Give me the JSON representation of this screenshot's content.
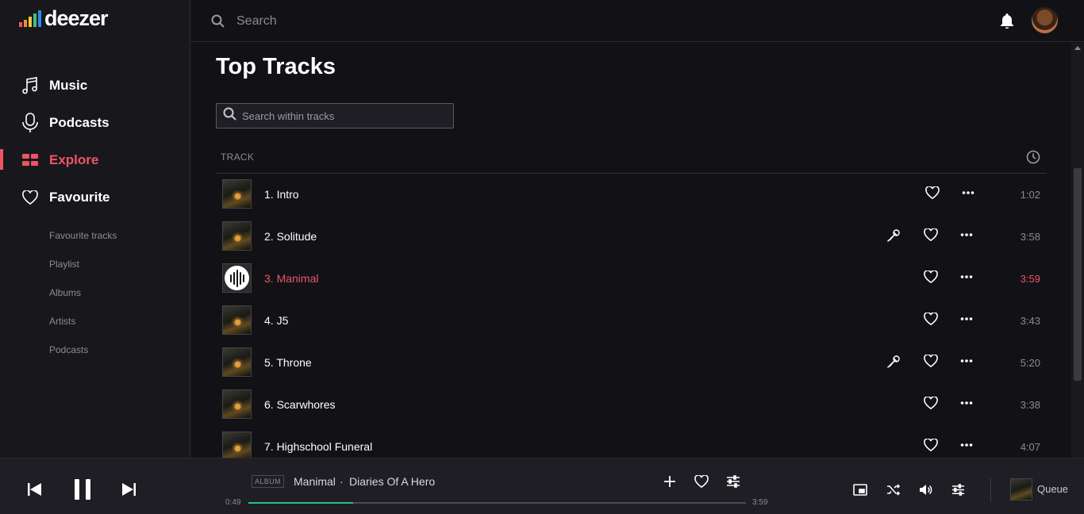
{
  "brand": {
    "name": "deezer",
    "bar_colors": [
      "#ef5466",
      "#f58f2d",
      "#f7c544",
      "#3ec27a",
      "#2b8be8",
      "#8b5ad8"
    ]
  },
  "sidebar": {
    "items": [
      {
        "label": "Music",
        "icon": "music-note-icon"
      },
      {
        "label": "Podcasts",
        "icon": "microphone-icon"
      },
      {
        "label": "Explore",
        "icon": "grid-icon",
        "active": true
      },
      {
        "label": "Favourite",
        "icon": "heart-icon"
      }
    ],
    "sub_items": [
      "Favourite tracks",
      "Playlist",
      "Albums",
      "Artists",
      "Podcasts"
    ]
  },
  "topbar": {
    "search_placeholder": "Search"
  },
  "page": {
    "title": "Top Tracks",
    "search_placeholder": "Search within tracks",
    "column_track": "TRACK"
  },
  "tracks": [
    {
      "name": "1. Intro",
      "duration": "1:02",
      "lyrics": false,
      "playing": false
    },
    {
      "name": "2. Solitude",
      "duration": "3:58",
      "lyrics": true,
      "playing": false
    },
    {
      "name": "3. Manimal",
      "duration": "3:59",
      "lyrics": false,
      "playing": true
    },
    {
      "name": "4. J5",
      "duration": "3:43",
      "lyrics": false,
      "playing": false
    },
    {
      "name": "5. Throne",
      "duration": "5:20",
      "lyrics": true,
      "playing": false
    },
    {
      "name": "6. Scarwhores",
      "duration": "3:38",
      "lyrics": false,
      "playing": false
    },
    {
      "name": "7. Highschool Funeral",
      "duration": "4:07",
      "lyrics": false,
      "playing": false
    }
  ],
  "player": {
    "tag": "ALBUM",
    "title": "Manimal",
    "separator": "·",
    "artist": "Diaries Of A Hero",
    "elapsed": "0:49",
    "total": "3:59",
    "progress": 0.21,
    "queue_label": "Queue"
  },
  "colors": {
    "accent": "#ef5466",
    "progress": "#26c281"
  }
}
